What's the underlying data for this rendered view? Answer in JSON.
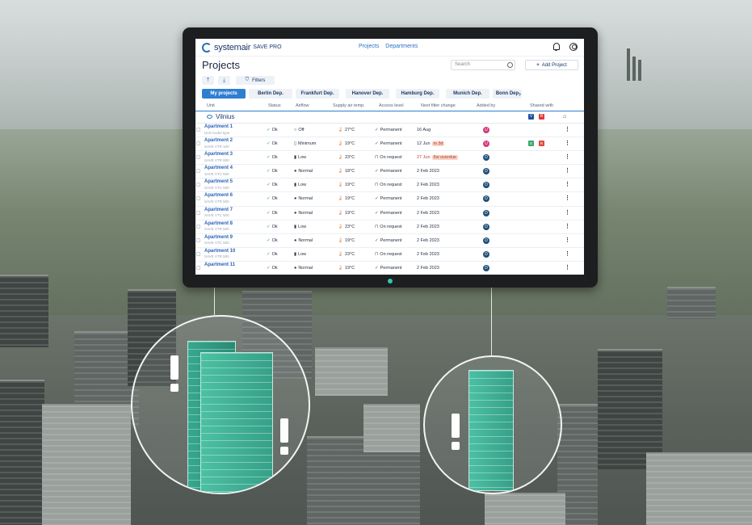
{
  "app": {
    "brand": "systemair",
    "brand_sub": "SAVE PRO",
    "nav": [
      "Projects",
      "Departments"
    ],
    "page_title": "Projects",
    "search_placeholder": "Search",
    "add_project_label": "Add Project",
    "filters_label": "Filters"
  },
  "departments": [
    {
      "label": "My projects",
      "active": true
    },
    {
      "label": "Berlin Dep.",
      "active": false
    },
    {
      "label": "Frankfurt Dep.",
      "active": false
    },
    {
      "label": "Hanover Dep.",
      "active": false
    },
    {
      "label": "Hamburg Dep.",
      "active": false
    },
    {
      "label": "Munich Dep.",
      "active": false
    },
    {
      "label": "Bonn Dep",
      "active": false
    }
  ],
  "columns": [
    "Unit",
    "Status",
    "Airflow",
    "Supply air temp.",
    "Access level",
    "Next filter change",
    "Added by",
    "Shared with"
  ],
  "group": {
    "name": "Vilnius",
    "shared": [
      "V",
      "R"
    ]
  },
  "rows": [
    {
      "name": "Apartment 1",
      "model": "Unit model type",
      "status": "Ok",
      "airflow": "Off",
      "temp": "27°C",
      "access": "Permanent",
      "filter": "16 Aug",
      "filter_extra": "",
      "added_by": "U",
      "tags": []
    },
    {
      "name": "Apartment 2",
      "model": "SAVE VTR 100",
      "status": "Ok",
      "airflow": "Minimum",
      "temp": "19°C",
      "access": "Permanent",
      "filter": "12 Jun",
      "filter_extra": "in 3d",
      "added_by": "U",
      "tags": [
        "G",
        "R"
      ]
    },
    {
      "name": "Apartment 3",
      "model": "SAVE VTR 500",
      "status": "Ok",
      "airflow": "Low",
      "temp": "23°C",
      "access": "On request",
      "filter": "27 Jun",
      "filter_extra": "5w overdue",
      "added_by": "D",
      "tags": []
    },
    {
      "name": "Apartment 4",
      "model": "SAVE VTC 500",
      "status": "Ok",
      "airflow": "Normal",
      "temp": "18°C",
      "access": "Permanent",
      "filter": "2 Feb 2023",
      "filter_extra": "",
      "added_by": "D",
      "tags": []
    },
    {
      "name": "Apartment 5",
      "model": "SAVE VTC 500",
      "status": "Ok",
      "airflow": "Low",
      "temp": "19°C",
      "access": "On request",
      "filter": "2 Feb 2023",
      "filter_extra": "",
      "added_by": "D",
      "tags": []
    },
    {
      "name": "Apartment 6",
      "model": "SAVE VTR 500",
      "status": "Ok",
      "airflow": "Normal",
      "temp": "19°C",
      "access": "Permanent",
      "filter": "2 Feb 2023",
      "filter_extra": "",
      "added_by": "D",
      "tags": []
    },
    {
      "name": "Apartment 7",
      "model": "SAVE VTC 500",
      "status": "Ok",
      "airflow": "Normal",
      "temp": "19°C",
      "access": "Permanent",
      "filter": "2 Feb 2023",
      "filter_extra": "",
      "added_by": "D",
      "tags": []
    },
    {
      "name": "Apartment 8",
      "model": "SAVE VTR 500",
      "status": "Ok",
      "airflow": "Low",
      "temp": "23°C",
      "access": "On request",
      "filter": "2 Feb 2023",
      "filter_extra": "",
      "added_by": "D",
      "tags": []
    },
    {
      "name": "Apartment 9",
      "model": "SAVE VTC 500",
      "status": "Ok",
      "airflow": "Normal",
      "temp": "19°C",
      "access": "Permanent",
      "filter": "2 Feb 2023",
      "filter_extra": "",
      "added_by": "D",
      "tags": []
    },
    {
      "name": "Apartment 10",
      "model": "SAVE VTR 500",
      "status": "Ok",
      "airflow": "Low",
      "temp": "23°C",
      "access": "On request",
      "filter": "2 Feb 2023",
      "filter_extra": "",
      "added_by": "D",
      "tags": []
    },
    {
      "name": "Apartment 11",
      "model": "",
      "status": "Ok",
      "airflow": "Normal",
      "temp": "19°C",
      "access": "Permanent",
      "filter": "2 Feb 2023",
      "filter_extra": "",
      "added_by": "D",
      "tags": []
    }
  ],
  "colors": {
    "accent": "#2f7fd1",
    "brand_navy": "#1a3a6b",
    "tower_green": "#2f9a82",
    "overdue_red": "#d43a2a"
  }
}
